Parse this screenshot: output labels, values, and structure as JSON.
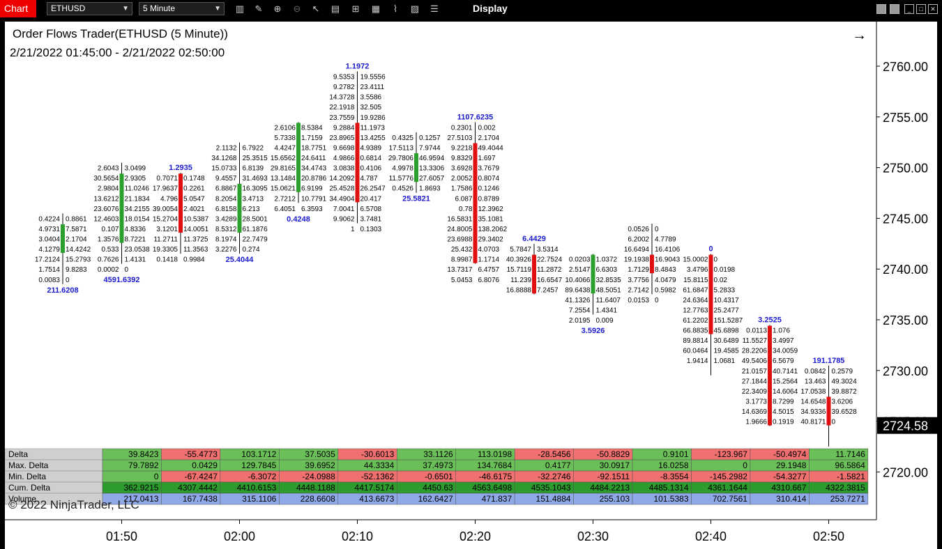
{
  "toolbar": {
    "tab_label": "Chart",
    "instrument": "ETHUSD",
    "interval": "5 Minute",
    "display_label": "Display",
    "icons": [
      "bar-type-icon",
      "draw-tool-icon",
      "zoom-in-icon",
      "zoom-out-icon",
      "pointer-icon",
      "properties-icon",
      "indicators-icon",
      "strategies-icon",
      "drawing-objects-icon",
      "templates-icon",
      "list-icon"
    ]
  },
  "chart": {
    "title": "Order Flows Trader(ETHUSD (5 Minute))",
    "range": "2/21/2022 01:45:00 - 2/21/2022 02:50:00",
    "copyright": "© 2022 NinjaTrader, LLC",
    "last_price": "2724.58",
    "price_ticks": [
      "2760.00",
      "2755.00",
      "2750.00",
      "2745.00",
      "2740.00",
      "2735.00",
      "2730.00",
      "2725.00",
      "2720.00"
    ],
    "time_ticks": [
      "01:50",
      "02:00",
      "02:10",
      "02:20",
      "02:30",
      "02:40",
      "02:50"
    ]
  },
  "chart_data": {
    "type": "table",
    "y_range": [
      2718,
      2762
    ],
    "row_step": 1,
    "bars": [
      {
        "o": 2742,
        "h": 2745,
        "l": 2739,
        "c": 2744,
        "bid": [
          "0.4224",
          "4.9731",
          "3.0404",
          "4.1279",
          "17.2124",
          "1.7514",
          "0.0083"
        ],
        "ask": [
          "0.8861",
          "7.5871",
          "2.1704",
          "14.4242",
          "15.2793",
          "9.8283",
          "0"
        ],
        "top": "",
        "bot": "211.6208"
      },
      {
        "o": 2743,
        "h": 2750,
        "l": 2741,
        "c": 2749,
        "bid": [
          "2.6043",
          "30.5654",
          "2.9804",
          "13.6212",
          "23.6076",
          "12.4603",
          "0.107",
          "1.3576",
          "0.533",
          "0.7626",
          "0.0002"
        ],
        "ask": [
          "3.0499",
          "2.9305",
          "11.0246",
          "21.1834",
          "34.2155",
          "18.0154",
          "4.8336",
          "8.7221",
          "23.0538",
          "1.4131",
          "0"
        ],
        "top": "",
        "bot": "4591.6392"
      },
      {
        "o": 2749,
        "h": 2749,
        "l": 2742,
        "c": 2744,
        "bid": [
          "0.7071",
          "17.9637",
          "4.796",
          "39.0054",
          "15.2704",
          "3.1201",
          "11.2711",
          "19.3305",
          "0.1418"
        ],
        "ask": [
          "0.1748",
          "0.2261",
          "5.0547",
          "2.4021",
          "10.5387",
          "14.0051",
          "11.3725",
          "11.3563",
          "0.9984"
        ],
        "top": "1.2935",
        "bot": ""
      },
      {
        "o": 2744,
        "h": 2752,
        "l": 2742,
        "c": 2748,
        "bid": [
          "2.1132",
          "34.1268",
          "15.0733",
          "9.4557",
          "6.8867",
          "8.2054",
          "6.8158",
          "3.4289",
          "8.5312",
          "8.1974",
          "3.2276"
        ],
        "ask": [
          "6.7922",
          "25.3515",
          "6.8139",
          "31.4693",
          "16.3095",
          "3.4713",
          "6.213",
          "28.5001",
          "61.1876",
          "22.7479",
          "0.274"
        ],
        "top": "",
        "bot": "25.4044"
      },
      {
        "o": 2748,
        "h": 2754,
        "l": 2747,
        "c": 2754,
        "bid": [
          "2.6106",
          "5.7338",
          "4.4247",
          "15.6562",
          "29.8165",
          "13.1484",
          "15.0621",
          "2.7212",
          "6.4051"
        ],
        "ask": [
          "8.5384",
          "1.7159",
          "18.7751",
          "24.6411",
          "34.4743",
          "20.8786",
          "6.9199",
          "10.7791",
          "6.3593"
        ],
        "top": "",
        "bot": "0.4248"
      },
      {
        "o": 2754,
        "h": 2759,
        "l": 2745,
        "c": 2747,
        "bid": [
          "9.5353",
          "9.2782",
          "14.3728",
          "22.1918",
          "23.7559",
          "9.2884",
          "23.8965",
          "9.6698",
          "4.9866",
          "3.0838",
          "14.2092",
          "25.4528",
          "34.4904",
          "7.0041",
          "9.9062",
          "1"
        ],
        "ask": [
          "19.5556",
          "23.4111",
          "3.5586",
          "32.505",
          "19.9286",
          "11.1973",
          "13.4255",
          "4.9389",
          "0.6814",
          "0.4106",
          "4.787",
          "26.2547",
          "20.417",
          "6.5708",
          "3.7481",
          "0.1303"
        ],
        "top": "1.1972",
        "bot": ""
      },
      {
        "o": 2749,
        "h": 2753,
        "l": 2748,
        "c": 2751,
        "bid": [
          "0.4325",
          "17.5113",
          "29.7806",
          "4.9978",
          "11.5776",
          "0.4526"
        ],
        "ask": [
          "0.1257",
          "7.9744",
          "46.9594",
          "13.3306",
          "27.6057",
          "1.8693"
        ],
        "top": "",
        "bot": "25.5821"
      },
      {
        "o": 2752,
        "h": 2754,
        "l": 2741,
        "c": 2741,
        "bid": [
          "0.2301",
          "27.5103",
          "9.2218",
          "9.8329",
          "3.6928",
          "2.0052",
          "1.7586",
          "6.087",
          "0.78",
          "16.5831",
          "24.8005",
          "23.6988",
          "25.432",
          "8.9987",
          "13.7317",
          "5.0453"
        ],
        "ask": [
          "0.002",
          "2.1704",
          "49.4044",
          "1.697",
          "3.7679",
          "0.8074",
          "0.1246",
          "0.8789",
          "12.3962",
          "35.1081",
          "138.2062",
          "29.3402",
          "4.0703",
          "1.1714",
          "6.4757",
          "6.8076"
        ],
        "top": "1107.6235",
        "bot": ""
      },
      {
        "o": 2741,
        "h": 2742,
        "l": 2738,
        "c": 2738,
        "bid": [
          "5.7847",
          "40.3926",
          "15.7119",
          "11.239",
          "16.8888"
        ],
        "ask": [
          "3.5314",
          "22.7524",
          "11.2872",
          "16.6547",
          "7.2457"
        ],
        "top": "6.4429",
        "bot": ""
      },
      {
        "o": 2738,
        "h": 2741,
        "l": 2736,
        "c": 2741,
        "bid": [
          "0.0203",
          "2.5147",
          "10.4066",
          "89.6438",
          "41.1326",
          "7.2554",
          "2.0195"
        ],
        "ask": [
          "1.0372",
          "6.6303",
          "32.8535",
          "48.5051",
          "11.6407",
          "1.4341",
          "0.009"
        ],
        "top": "",
        "bot": "3.5926"
      },
      {
        "o": 2741,
        "h": 2744,
        "l": 2738,
        "c": 2740,
        "bid": [
          "0.0526",
          "6.2002",
          "16.6494",
          "19.1938",
          "1.7129",
          "3.7756",
          "2.7142",
          "0.0153"
        ],
        "ask": [
          "0",
          "4.7789",
          "16.4106",
          "16.9043",
          "8.4843",
          "4.0479",
          "0.5982",
          "0"
        ],
        "top": "",
        "bot": ""
      },
      {
        "o": 2741,
        "h": 2741,
        "l": 2730,
        "c": 2734,
        "bid": [
          "15.0002",
          "3.4796",
          "15.8115",
          "61.6847",
          "24.6364",
          "12.7763",
          "61.2202",
          "66.8835",
          "89.8814",
          "60.0464",
          "1.9414"
        ],
        "ask": [
          "0",
          "0.0198",
          "0.02",
          "5.2833",
          "10.4317",
          "25.2477",
          "151.5287",
          "45.6898",
          "30.6489",
          "19.4585",
          "1.0681"
        ],
        "top": "0",
        "bot": ""
      },
      {
        "o": 2734,
        "h": 2734,
        "l": 2725,
        "c": 2725,
        "bid": [
          "0.0113",
          "11.5527",
          "28.2206",
          "49.5406",
          "21.0157",
          "27.1844",
          "22.3409",
          "3.1773",
          "14.6369",
          "1.9666"
        ],
        "ask": [
          "1.076",
          "3.4997",
          "34.0059",
          "6.5679",
          "40.7141",
          "15.2564",
          "14.6064",
          "8.7299",
          "4.5015",
          "0.1919"
        ],
        "top": "3.2525",
        "bot": ""
      },
      {
        "o": 2727,
        "h": 2730,
        "l": 2723,
        "c": 2725,
        "bid": [
          "0.0842",
          "13.463",
          "17.0538",
          "14.6548",
          "34.9336",
          "40.8171"
        ],
        "ask": [
          "0.2579",
          "49.3024",
          "39.8872",
          "3.6206",
          "39.6528",
          "0"
        ],
        "top": "191.1785",
        "bot": ""
      }
    ],
    "stats": {
      "labels": [
        "Delta",
        "Max. Delta",
        "Min. Delta",
        "Cum. Delta",
        "Volume"
      ],
      "rows": [
        [
          "39.8423",
          "-55.4773",
          "103.1712",
          "37.5035",
          "-30.6013",
          "33.1126",
          "113.0198",
          "-28.5456",
          "-50.8829",
          "0.9101",
          "-123.967",
          "-50.4974",
          "11.7146"
        ],
        [
          "79.7892",
          "0.0429",
          "129.7845",
          "39.6952",
          "44.3334",
          "37.4973",
          "134.7684",
          "0.4177",
          "30.0917",
          "16.0258",
          "0",
          "29.1948",
          "96.5864"
        ],
        [
          "0",
          "-67.4247",
          "-6.3072",
          "-24.0988",
          "-52.1362",
          "-0.6501",
          "-46.6175",
          "-32.2746",
          "-92.1511",
          "-8.3554",
          "-145.2982",
          "-54.3277",
          "-1.5821"
        ],
        [
          "362.9215",
          "4307.4442",
          "4410.6153",
          "4448.1188",
          "4417.5174",
          "4450.63",
          "4563.6498",
          "4535.1043",
          "4484.2213",
          "4485.1314",
          "4361.1644",
          "4310.667",
          "4322.3815"
        ],
        [
          "217.0413",
          "167.7438",
          "315.1106",
          "228.6608",
          "413.6673",
          "162.6427",
          "471.837",
          "151.4884",
          "255.103",
          "101.5383",
          "702.7561",
          "310.414",
          "253.7271"
        ]
      ]
    }
  },
  "colors": {
    "up": "#2ca02c",
    "down": "#e01010",
    "buy": "#1a1acd",
    "sell": "#e01010",
    "positive": "#6bbf59",
    "negative": "#f07070",
    "cum": "#2e9b2e",
    "volume": "#8fa8e8"
  }
}
